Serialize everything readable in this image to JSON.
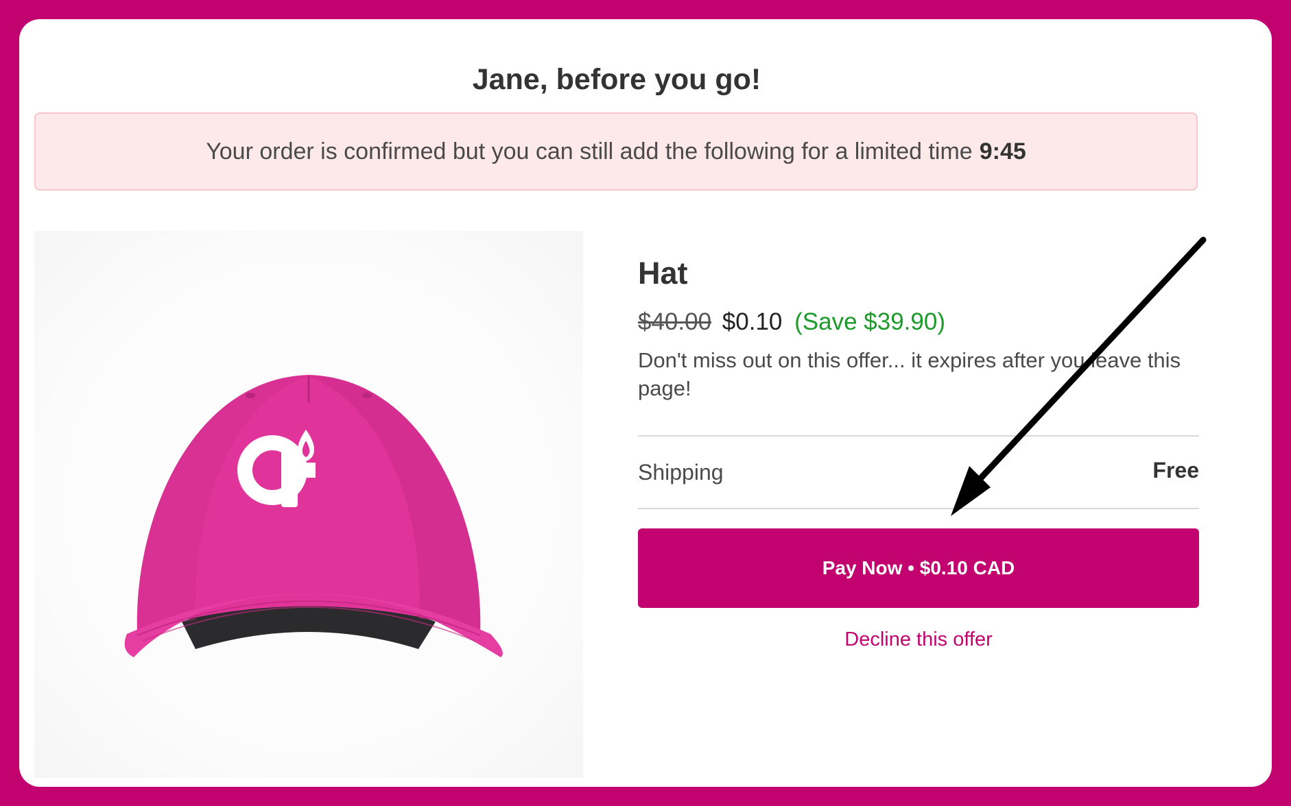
{
  "header": {
    "title": "Jane, before you go!"
  },
  "alert": {
    "message": "Your order is confirmed but you can still add the following for a limited time",
    "timer": "9:45"
  },
  "product": {
    "name": "Hat",
    "original_price": "$40.00",
    "offer_price": "$0.10",
    "savings": "(Save $39.90)",
    "description": "Don't miss out on this offer... it expires after you leave this page!",
    "image_icon": "pink-baseball-cap-with-logo"
  },
  "shipping": {
    "label": "Shipping",
    "value": "Free"
  },
  "actions": {
    "pay_label": "Pay Now • $0.10 CAD",
    "decline_label": "Decline this offer"
  },
  "colors": {
    "brand": "#c2036f",
    "save_green": "#1c9b2b",
    "alert_bg": "#fde8ea",
    "annotation_arrow": "#000000"
  }
}
